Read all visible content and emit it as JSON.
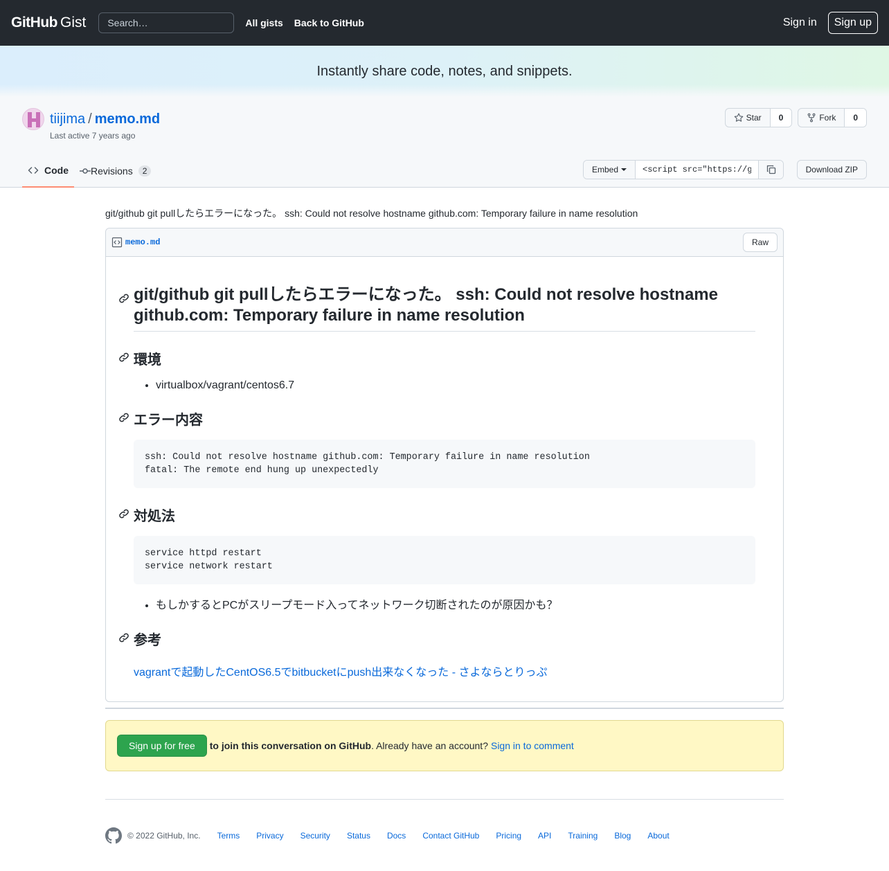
{
  "header": {
    "logo_github": "GitHub",
    "logo_gist": "Gist",
    "search_placeholder": "Search…",
    "nav": [
      "All gists",
      "Back to GitHub"
    ],
    "signin": "Sign in",
    "signup": "Sign up"
  },
  "banner": {
    "text": "Instantly share code, notes, and snippets."
  },
  "gist": {
    "owner": "tiijima",
    "separator": "/",
    "name": "memo.md",
    "last_active": "Last active 7 years ago",
    "star_label": "Star",
    "star_count": "0",
    "fork_label": "Fork",
    "fork_count": "0"
  },
  "tabs": {
    "code": "Code",
    "revisions": "Revisions",
    "revisions_count": "2"
  },
  "embed": {
    "label": "Embed",
    "value": "<script src=\"https://g",
    "download": "Download ZIP"
  },
  "description": "git/github git pullしたらエラーになった。 ssh: Could not resolve hostname github.com: Temporary failure in name resolution",
  "file": {
    "name": "memo.md",
    "raw": "Raw"
  },
  "markdown": {
    "h1": "git/github git pullしたらエラーになった。 ssh: Could not resolve hostname github.com: Temporary failure in name resolution",
    "h2_env": "環境",
    "env_item": "virtualbox/vagrant/centos6.7",
    "h2_error": "エラー内容",
    "error_code": "ssh: Could not resolve hostname github.com: Temporary failure in name resolution\nfatal: The remote end hung up unexpectedly",
    "h2_fix": "対処法",
    "fix_code": "service httpd restart\nservice network restart",
    "fix_note": "もしかするとPCがスリープモード入ってネットワーク切断されたのが原因かも？",
    "h2_ref": "参考",
    "ref_link": "vagrantで起動したCentOS6.5でbitbucketにpush出来なくなった - さよならとりっぷ"
  },
  "signup_box": {
    "button": "Sign up for free",
    "join": "to join this conversation on GitHub",
    "already": ". Already have an account?",
    "signin_link": "Sign in to comment"
  },
  "footer": {
    "copyright": "© 2022 GitHub, Inc.",
    "links": [
      "Terms",
      "Privacy",
      "Security",
      "Status",
      "Docs",
      "Contact GitHub",
      "Pricing",
      "API",
      "Training",
      "Blog",
      "About"
    ]
  }
}
